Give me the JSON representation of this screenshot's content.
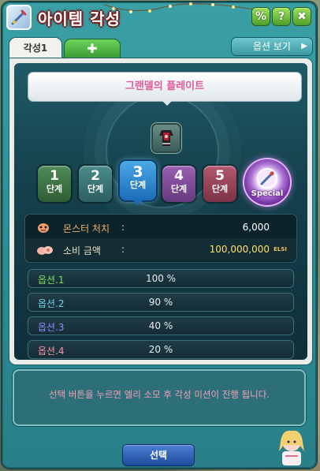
{
  "window": {
    "title": "아이템 각성",
    "top_buttons": [
      {
        "label": "%",
        "icon": "percent-icon"
      },
      {
        "label": "?",
        "icon": "help-icon"
      },
      {
        "label": "✖",
        "icon": "close-icon"
      }
    ]
  },
  "tabs": {
    "active_label": "각성1",
    "add_label": "✚",
    "option_view_label": "옵션 보기",
    "option_view_arrow": "▶"
  },
  "item": {
    "name": "그랜델의 플레이트",
    "icon": "armor-item-icon"
  },
  "stages": [
    {
      "num": "1",
      "unit": "단계",
      "color": "#2d5e33"
    },
    {
      "num": "2",
      "unit": "단계",
      "color": "#2d5f61"
    },
    {
      "num": "3",
      "unit": "단계",
      "color": "#1d6bb8",
      "selected": true
    },
    {
      "num": "4",
      "unit": "단계",
      "color": "#673a7f"
    },
    {
      "num": "5",
      "unit": "단계",
      "color": "#7c3247"
    }
  ],
  "special": {
    "label": "Special"
  },
  "requirements": {
    "monster": {
      "label": "몬스터 처치",
      "colon": ":",
      "value": "6,000"
    },
    "cost": {
      "label": "소비 금액",
      "colon": ":",
      "value": "100,000,000",
      "unit": "ELSI"
    }
  },
  "options": [
    {
      "label": "옵션.1",
      "percent": "100 %",
      "color": "#7be05c"
    },
    {
      "label": "옵션.2",
      "percent": "90 %",
      "color": "#6fd6ea"
    },
    {
      "label": "옵션.3",
      "percent": "40 %",
      "color": "#8b8dff"
    },
    {
      "label": "옵션.4",
      "percent": "20 %",
      "color": "#ff8fa8"
    }
  ],
  "description": "선택 버튼을 누르면 엘리 소모 후 각성 미션이 진행 됩니다.",
  "select_button": {
    "label": "선택"
  }
}
